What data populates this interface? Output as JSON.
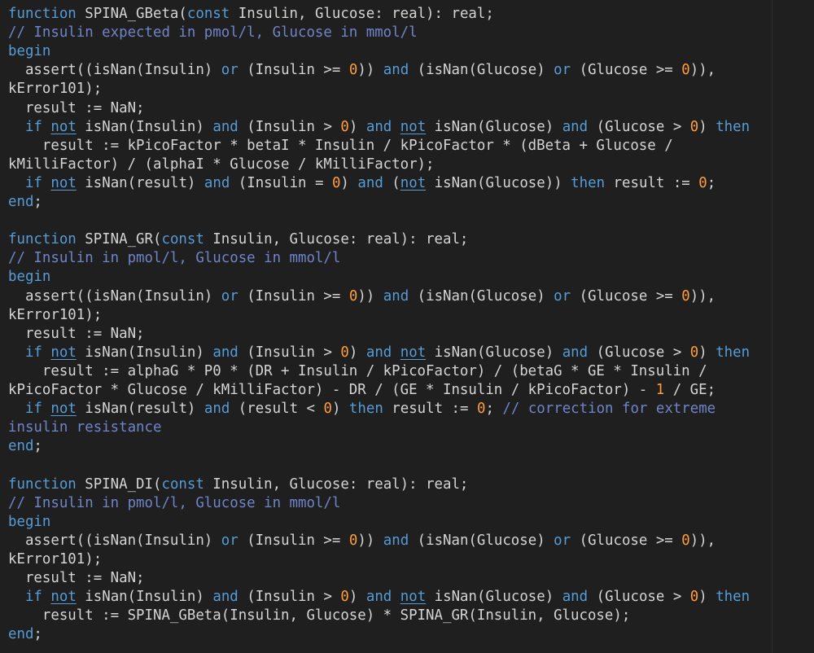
{
  "editor": {
    "background": "#1f1f1f",
    "colors": {
      "keyword": "#569cd6",
      "comment": "#6f84c9",
      "number": "#ff9d3b",
      "text": "#d4d4d4"
    },
    "lines": [
      [
        [
          "kw",
          "function"
        ],
        [
          "t",
          " SPINA_GBeta("
        ],
        [
          "kw",
          "const"
        ],
        [
          "t",
          " Insulin, Glucose: real): real;"
        ]
      ],
      [
        [
          "cm",
          "// Insulin expected in pmol/l, Glucose in mmol/l"
        ]
      ],
      [
        [
          "kw",
          "begin"
        ]
      ],
      [
        [
          "t",
          "  assert((isNan(Insulin) "
        ],
        [
          "kw",
          "or"
        ],
        [
          "t",
          " (Insulin >= "
        ],
        [
          "nm",
          "0"
        ],
        [
          "t",
          ")) "
        ],
        [
          "kw",
          "and"
        ],
        [
          "t",
          " (isNan(Glucose) "
        ],
        [
          "kw",
          "or"
        ],
        [
          "t",
          " (Glucose >= "
        ],
        [
          "nm",
          "0"
        ],
        [
          "t",
          ")),"
        ]
      ],
      [
        [
          "t",
          "kError101);"
        ]
      ],
      [
        [
          "t",
          "  result := NaN;"
        ]
      ],
      [
        [
          "t",
          "  "
        ],
        [
          "kw",
          "if"
        ],
        [
          "t",
          " "
        ],
        [
          "ulkw",
          "not"
        ],
        [
          "t",
          " isNan(Insulin) "
        ],
        [
          "kw",
          "and"
        ],
        [
          "t",
          " (Insulin > "
        ],
        [
          "nm",
          "0"
        ],
        [
          "t",
          ") "
        ],
        [
          "kw",
          "and"
        ],
        [
          "t",
          " "
        ],
        [
          "ulkw",
          "not"
        ],
        [
          "t",
          " isNan(Glucose) "
        ],
        [
          "kw",
          "and"
        ],
        [
          "t",
          " (Glucose > "
        ],
        [
          "nm",
          "0"
        ],
        [
          "t",
          ") "
        ],
        [
          "kw",
          "then"
        ]
      ],
      [
        [
          "t",
          "    result := kPicoFactor * betaI * Insulin / kPicoFactor * (dBeta + Glucose /"
        ]
      ],
      [
        [
          "t",
          "kMilliFactor) / (alphaI * Glucose / kMilliFactor);"
        ]
      ],
      [
        [
          "t",
          "  "
        ],
        [
          "kw",
          "if"
        ],
        [
          "t",
          " "
        ],
        [
          "ulkw",
          "not"
        ],
        [
          "t",
          " isNan(result) "
        ],
        [
          "kw",
          "and"
        ],
        [
          "t",
          " (Insulin = "
        ],
        [
          "nm",
          "0"
        ],
        [
          "t",
          ") "
        ],
        [
          "kw",
          "and"
        ],
        [
          "t",
          " ("
        ],
        [
          "ulkw",
          "not"
        ],
        [
          "t",
          " isNan(Glucose)) "
        ],
        [
          "kw",
          "then"
        ],
        [
          "t",
          " result := "
        ],
        [
          "nm",
          "0"
        ],
        [
          "t",
          ";"
        ]
      ],
      [
        [
          "kw",
          "end"
        ],
        [
          "t",
          ";"
        ]
      ],
      [],
      [
        [
          "kw",
          "function"
        ],
        [
          "t",
          " SPINA_GR("
        ],
        [
          "kw",
          "const"
        ],
        [
          "t",
          " Insulin, Glucose: real): real;"
        ]
      ],
      [
        [
          "cm",
          "// Insulin in pmol/l, Glucose in mmol/l"
        ]
      ],
      [
        [
          "kw",
          "begin"
        ]
      ],
      [
        [
          "t",
          "  assert((isNan(Insulin) "
        ],
        [
          "kw",
          "or"
        ],
        [
          "t",
          " (Insulin >= "
        ],
        [
          "nm",
          "0"
        ],
        [
          "t",
          ")) "
        ],
        [
          "kw",
          "and"
        ],
        [
          "t",
          " (isNan(Glucose) "
        ],
        [
          "kw",
          "or"
        ],
        [
          "t",
          " (Glucose >= "
        ],
        [
          "nm",
          "0"
        ],
        [
          "t",
          ")),"
        ]
      ],
      [
        [
          "t",
          "kError101);"
        ]
      ],
      [
        [
          "t",
          "  result := NaN;"
        ]
      ],
      [
        [
          "t",
          "  "
        ],
        [
          "kw",
          "if"
        ],
        [
          "t",
          " "
        ],
        [
          "ulkw",
          "not"
        ],
        [
          "t",
          " isNan(Insulin) "
        ],
        [
          "kw",
          "and"
        ],
        [
          "t",
          " (Insulin > "
        ],
        [
          "nm",
          "0"
        ],
        [
          "t",
          ") "
        ],
        [
          "kw",
          "and"
        ],
        [
          "t",
          " "
        ],
        [
          "ulkw",
          "not"
        ],
        [
          "t",
          " isNan(Glucose) "
        ],
        [
          "kw",
          "and"
        ],
        [
          "t",
          " (Glucose > "
        ],
        [
          "nm",
          "0"
        ],
        [
          "t",
          ") "
        ],
        [
          "kw",
          "then"
        ]
      ],
      [
        [
          "t",
          "    result := alphaG * P0 * (DR + Insulin / kPicoFactor) / (betaG * GE * Insulin /"
        ]
      ],
      [
        [
          "t",
          "kPicoFactor * Glucose / kMilliFactor) - DR / (GE * Insulin / kPicoFactor) - "
        ],
        [
          "nm",
          "1"
        ],
        [
          "t",
          " / GE;"
        ]
      ],
      [
        [
          "t",
          "  "
        ],
        [
          "kw",
          "if"
        ],
        [
          "t",
          " "
        ],
        [
          "ulkw",
          "not"
        ],
        [
          "t",
          " isNan(result) "
        ],
        [
          "kw",
          "and"
        ],
        [
          "t",
          " (result < "
        ],
        [
          "nm",
          "0"
        ],
        [
          "t",
          ") "
        ],
        [
          "kw",
          "then"
        ],
        [
          "t",
          " result := "
        ],
        [
          "nm",
          "0"
        ],
        [
          "t",
          "; "
        ],
        [
          "cm",
          "// correction for extreme"
        ]
      ],
      [
        [
          "cm",
          "insulin resistance"
        ]
      ],
      [
        [
          "kw",
          "end"
        ],
        [
          "t",
          ";"
        ]
      ],
      [],
      [
        [
          "kw",
          "function"
        ],
        [
          "t",
          " SPINA_DI("
        ],
        [
          "kw",
          "const"
        ],
        [
          "t",
          " Insulin, Glucose: real): real;"
        ]
      ],
      [
        [
          "cm",
          "// Insulin in pmol/l, Glucose in mmol/l"
        ]
      ],
      [
        [
          "kw",
          "begin"
        ]
      ],
      [
        [
          "t",
          "  assert((isNan(Insulin) "
        ],
        [
          "kw",
          "or"
        ],
        [
          "t",
          " (Insulin >= "
        ],
        [
          "nm",
          "0"
        ],
        [
          "t",
          ")) "
        ],
        [
          "kw",
          "and"
        ],
        [
          "t",
          " (isNan(Glucose) "
        ],
        [
          "kw",
          "or"
        ],
        [
          "t",
          " (Glucose >= "
        ],
        [
          "nm",
          "0"
        ],
        [
          "t",
          ")),"
        ]
      ],
      [
        [
          "t",
          "kError101);"
        ]
      ],
      [
        [
          "t",
          "  result := NaN;"
        ]
      ],
      [
        [
          "t",
          "  "
        ],
        [
          "kw",
          "if"
        ],
        [
          "t",
          " "
        ],
        [
          "ulkw",
          "not"
        ],
        [
          "t",
          " isNan(Insulin) "
        ],
        [
          "kw",
          "and"
        ],
        [
          "t",
          " (Insulin > "
        ],
        [
          "nm",
          "0"
        ],
        [
          "t",
          ") "
        ],
        [
          "kw",
          "and"
        ],
        [
          "t",
          " "
        ],
        [
          "ulkw",
          "not"
        ],
        [
          "t",
          " isNan(Glucose) "
        ],
        [
          "kw",
          "and"
        ],
        [
          "t",
          " (Glucose > "
        ],
        [
          "nm",
          "0"
        ],
        [
          "t",
          ") "
        ],
        [
          "kw",
          "then"
        ]
      ],
      [
        [
          "t",
          "    result := SPINA_GBeta(Insulin, Glucose) * SPINA_GR(Insulin, Glucose);"
        ]
      ],
      [
        [
          "kw",
          "end"
        ],
        [
          "t",
          ";"
        ]
      ]
    ]
  }
}
